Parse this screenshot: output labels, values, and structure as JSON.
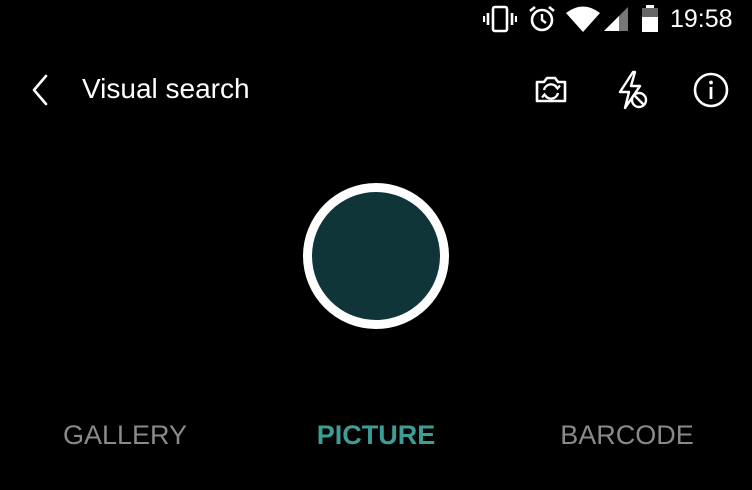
{
  "status_bar": {
    "time": "19:58",
    "icons": [
      "vibrate-icon",
      "alarm-icon",
      "wifi-icon",
      "signal-icon",
      "battery-icon"
    ]
  },
  "toolbar": {
    "title": "Visual search",
    "back_icon": "chevron-left-icon",
    "switch_camera_icon": "switch-camera-icon",
    "flash_icon": "flash-off-icon",
    "info_icon": "info-icon"
  },
  "shutter": {
    "inner_color": "#0f3538",
    "ring_color": "#ffffff"
  },
  "modes": {
    "tabs": [
      {
        "label": "GALLERY",
        "active": false
      },
      {
        "label": "PICTURE",
        "active": true
      },
      {
        "label": "BARCODE",
        "active": false
      }
    ],
    "active_color": "#3e9c97",
    "inactive_color": "#8a8a8a"
  }
}
